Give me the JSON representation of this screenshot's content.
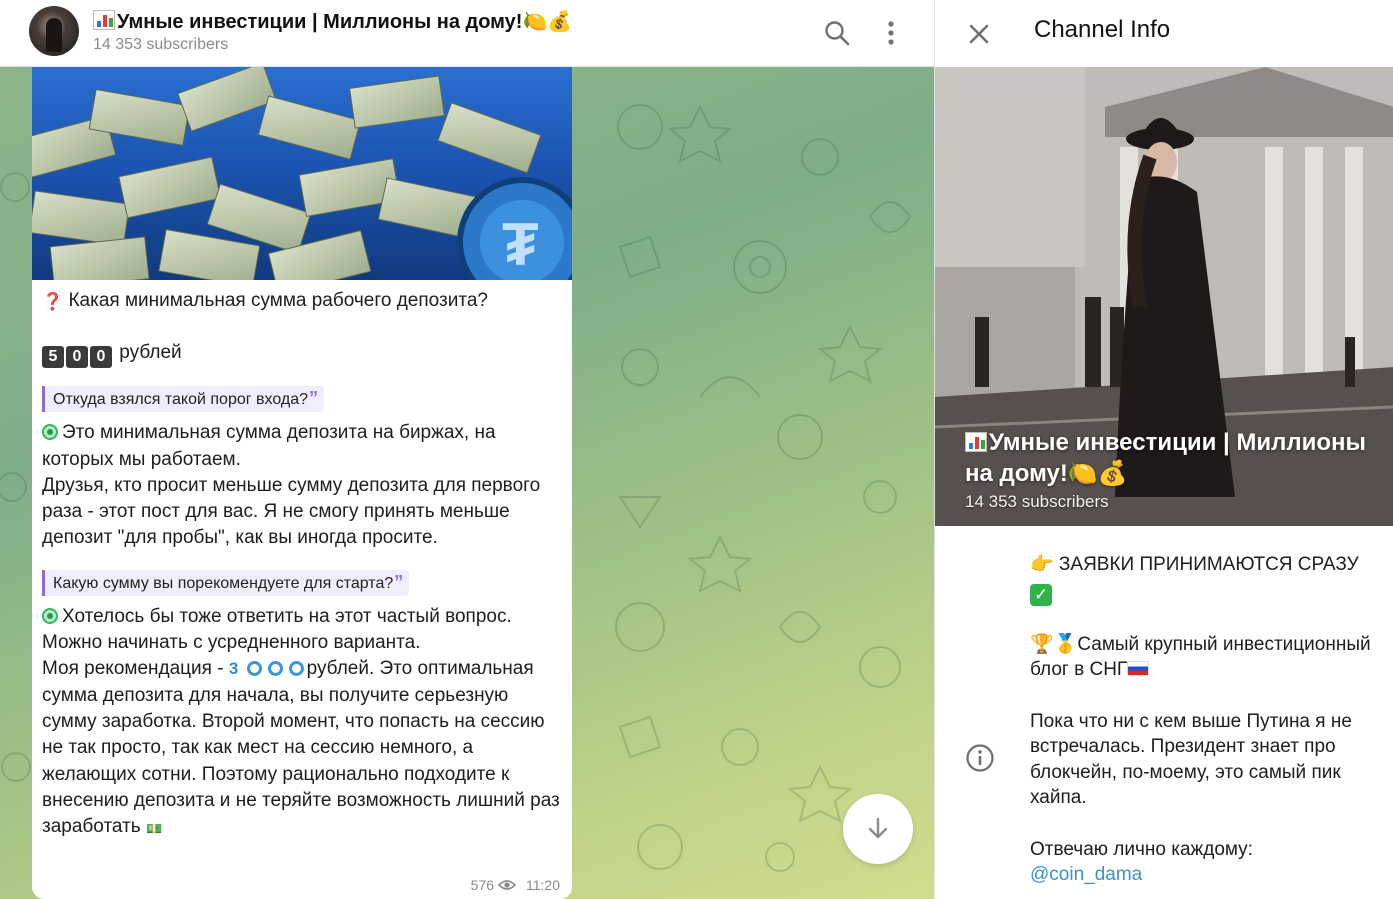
{
  "chat": {
    "title": "Умные инвестиции | Миллионы на дому!🍋💰",
    "subscribers": "14 353 subscribers"
  },
  "message": {
    "question1": "Какая минимальная сумма рабочего депозита?",
    "amount_digits": [
      "5",
      "0",
      "0"
    ],
    "amount_unit": "рублей",
    "quote1": "Откуда взялся такой порог входа?",
    "answer1_line1": "Это минимальная сумма депозита на биржах, на",
    "answer1_line2": "которых мы работаем.",
    "answer1_para": "Друзья, кто просит меньше сумму депозита для первого раза - этот пост для вас. Я не смогу принять меньше депозит \"для пробы\", как вы иногда просите.",
    "quote2": "Какую сумму вы порекомендуете для старта?",
    "answer2_line1": "Хотелось бы тоже ответить на этот частый вопрос.",
    "answer2_line2": "Можно начинать с усредненного варианта.",
    "recommend_prefix": "Моя рекомендация - ",
    "recommend_digit": "3",
    "recommend_rest": "рублей. Это оптимальная сумма депозита для начала, вы получите серьезную сумму заработка. Второй момент, что попасть на сессию не так просто, так как мест на сессию немного, а желающих сотни. Поэтому рационально подходите к внесению депозита и не теряйте возможность лишний раз заработать",
    "views": "576",
    "time": "11:20"
  },
  "info_panel": {
    "title": "Channel Info",
    "channel_title": "Умные инвестиции | Миллионы на дому!🍋💰",
    "subscribers": "14 353 subscribers",
    "about_line1": "👉 ЗАЯВКИ ПРИНИМАЮТСЯ СРАЗУ",
    "about_line2": "🏆🥇Самый крупный инвестиционный блог в СНГ",
    "about_line3": "Пока что ни с кем выше Путина я не встречалась. Президент знает про блокчейн, по-моему, это самый пик хайпа.",
    "about_line4": "Отвечаю лично каждому:",
    "contact": "@coin_dama"
  },
  "icons": {
    "search": "search-icon",
    "menu": "more-vertical-icon",
    "close": "close-icon",
    "info": "info-icon",
    "scroll": "chevron-down-icon",
    "views": "eye-icon"
  },
  "colors": {
    "accent": "#3a90d4",
    "quote_border": "#8a6cd6",
    "dot_green": "#30b85a"
  }
}
